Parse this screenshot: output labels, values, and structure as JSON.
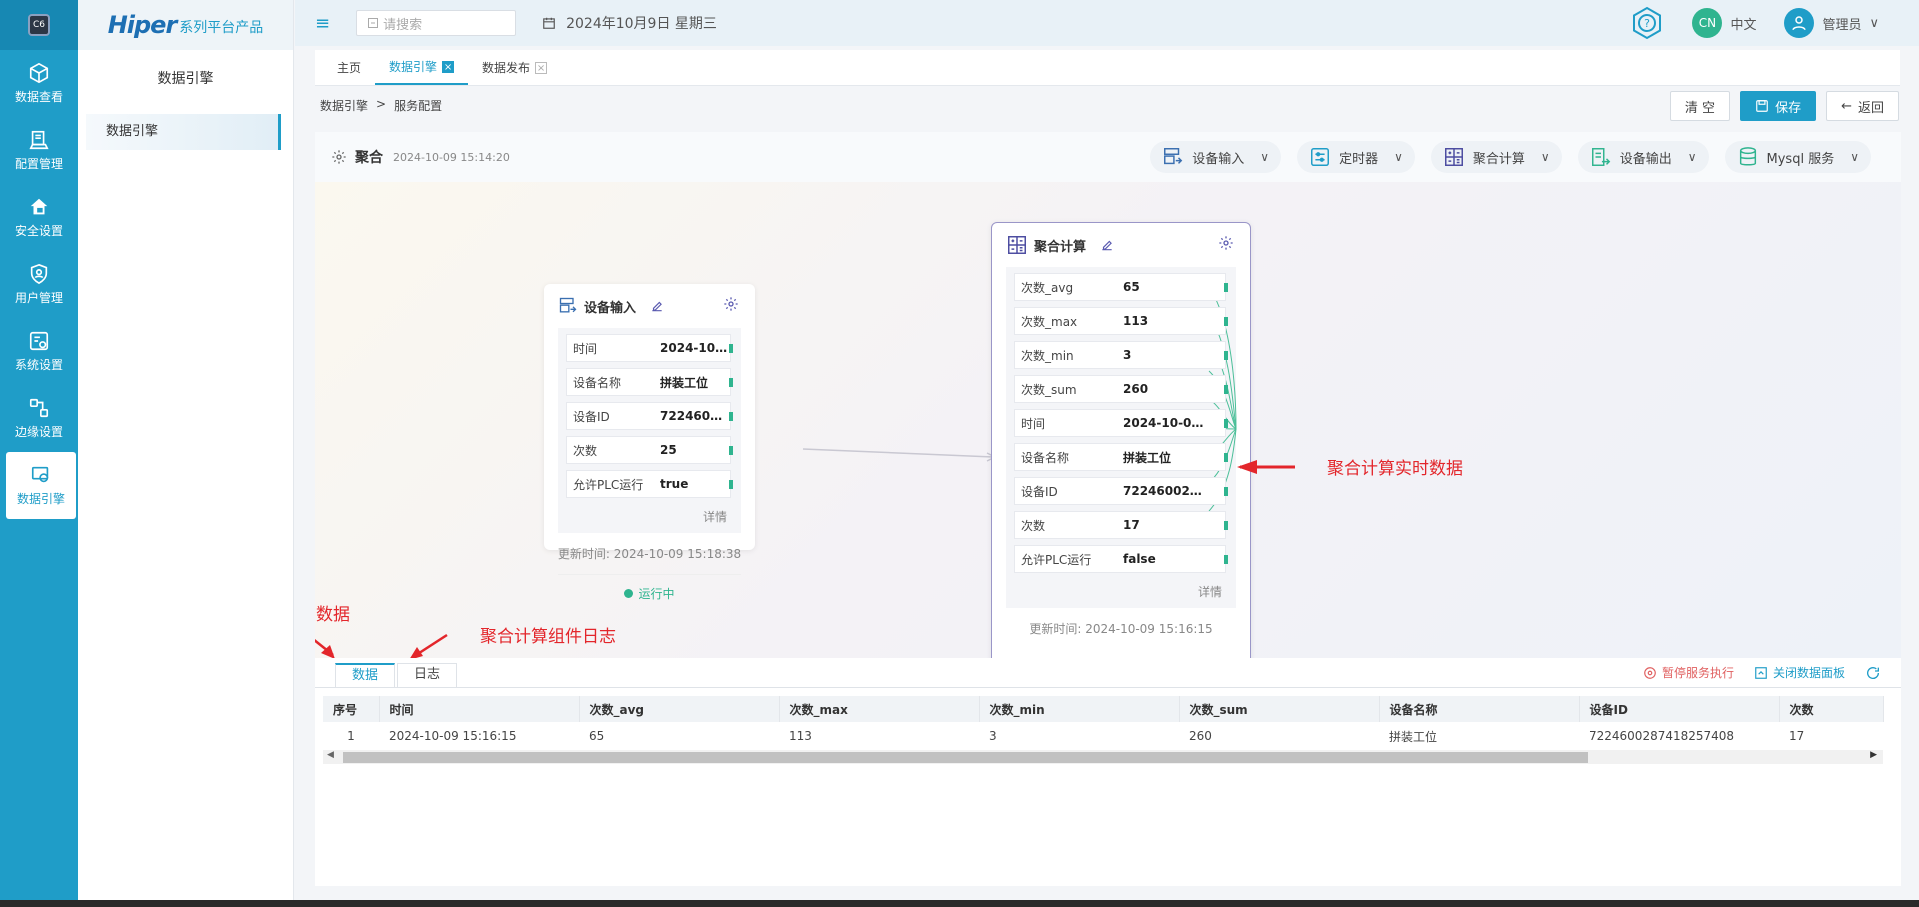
{
  "sidebar_icons": {
    "logo_text": "C6",
    "items": [
      {
        "label": "数据查看",
        "icon": "cube-icon"
      },
      {
        "label": "配置管理",
        "icon": "config-icon"
      },
      {
        "label": "安全设置",
        "icon": "home-lock-icon"
      },
      {
        "label": "用户管理",
        "icon": "shield-user-icon"
      },
      {
        "label": "系统设置",
        "icon": "system-icon"
      },
      {
        "label": "边缘设置",
        "icon": "edge-icon"
      },
      {
        "label": "数据引擎",
        "icon": "engine-icon"
      }
    ]
  },
  "brand": {
    "name": "Hiper",
    "suffix": "系列平台产品"
  },
  "sidebar": {
    "title": "数据引擎",
    "item": "数据引擎"
  },
  "header": {
    "search_placeholder": "请搜索",
    "date": "2024年10月9日 星期三",
    "lang_badge": "CN",
    "lang_label": "中文",
    "user": "管理员"
  },
  "tabs": [
    {
      "label": "主页",
      "closable": false,
      "active": false
    },
    {
      "label": "数据引擎",
      "closable": true,
      "active": true
    },
    {
      "label": "数据发布",
      "closable": true,
      "active": false
    }
  ],
  "breadcrumb": {
    "parent": "数据引擎",
    "sep": ">",
    "current": "服务配置"
  },
  "actions": {
    "clear": "清 空",
    "save": "保存",
    "back": "返回"
  },
  "toolbar": {
    "title": "聚合",
    "time": "2024-10-09 15:14:20",
    "pills": [
      "设备输入",
      "定时器",
      "聚合计算",
      "设备输出",
      "Mysql 服务"
    ]
  },
  "node_input": {
    "title": "设备输入",
    "rows": [
      {
        "k": "时间",
        "v": "2024-10-09..."
      },
      {
        "k": "设备名称",
        "v": "拼装工位"
      },
      {
        "k": "设备ID",
        "v": "7224600287..."
      },
      {
        "k": "次数",
        "v": "25"
      },
      {
        "k": "允许PLC运行",
        "v": "true"
      }
    ],
    "detail": "详情",
    "updated": "更新时间: 2024-10-09 15:18:38",
    "status": "运行中"
  },
  "node_agg": {
    "title": "聚合计算",
    "rows": [
      {
        "k": "次数_avg",
        "v": "65"
      },
      {
        "k": "次数_max",
        "v": "113"
      },
      {
        "k": "次数_min",
        "v": "3"
      },
      {
        "k": "次数_sum",
        "v": "260"
      },
      {
        "k": "时间",
        "v": "2024-10-09..."
      },
      {
        "k": "设备名称",
        "v": "拼装工位"
      },
      {
        "k": "设备ID",
        "v": "7224600287..."
      },
      {
        "k": "次数",
        "v": "17"
      },
      {
        "k": "允许PLC运行",
        "v": "false"
      }
    ],
    "detail": "详情",
    "updated": "更新时间: 2024-10-09 15:16:15"
  },
  "annotations": {
    "realtime": "聚合计算实时数据",
    "out": "出数据",
    "log": "聚合计算组件日志"
  },
  "bottom": {
    "tabs": [
      "数据",
      "日志"
    ],
    "pause": "暂停服务执行",
    "close_panel": "关闭数据面板",
    "columns": [
      "序号",
      "时间",
      "次数_avg",
      "次数_max",
      "次数_min",
      "次数_sum",
      "设备名称",
      "设备ID",
      "次数"
    ],
    "rows": [
      [
        "1",
        "2024-10-09 15:16:15",
        "65",
        "113",
        "3",
        "260",
        "拼装工位",
        "7224600287418257408",
        "17"
      ]
    ]
  },
  "colors": {
    "accent": "#1f9dc8",
    "link_green": "#2fb48f",
    "annotation_red": "#e3262b"
  }
}
